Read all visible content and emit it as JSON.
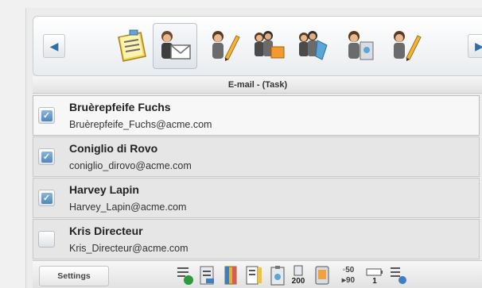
{
  "toolbar": {
    "tools": [
      {
        "icon": "notepad-icon"
      },
      {
        "icon": "person-email-icon",
        "selected": true
      },
      {
        "icon": "person-pencil-icon"
      },
      {
        "icon": "people-folder-icon"
      },
      {
        "icon": "people-tag-icon"
      },
      {
        "icon": "person-clipboard-icon"
      },
      {
        "icon": "person-pencil-icon"
      }
    ],
    "left_arrow": "◀",
    "right_arrow": "▶"
  },
  "title": "E-mail - (Task)",
  "contacts": [
    {
      "name": "Bruèrepfeife Fuchs",
      "email": "Bruèrepfeife_Fuchs@acme.com",
      "checked": true,
      "selected": true
    },
    {
      "name": "Coniglio di Rovo",
      "email": "coniglio_dirovo@acme.com",
      "checked": true,
      "selected": false
    },
    {
      "name": "Harvey Lapin",
      "email": "Harvey_Lapin@acme.com",
      "checked": true,
      "selected": false
    },
    {
      "name": "Kris Directeur",
      "email": "Kris_Directeur@acme.com",
      "checked": false,
      "selected": false
    }
  ],
  "bottom": {
    "settings_label": "Settings",
    "count_200": "200",
    "stat_a": "◦50",
    "stat_b": "▸90",
    "count_1": "1"
  },
  "colors": {
    "accent": "#4f86bd",
    "selected_row": "#f7f7f7",
    "row": "#e6e6e6"
  }
}
